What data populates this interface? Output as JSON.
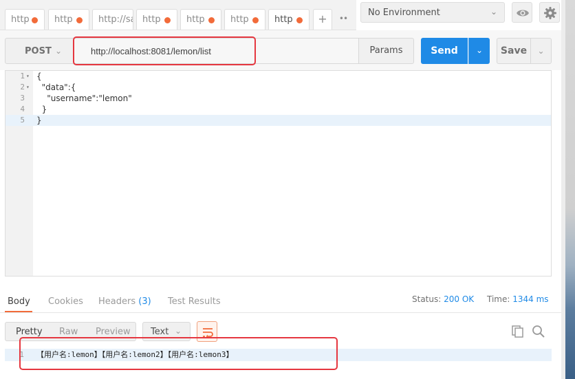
{
  "tabs": [
    {
      "label": "http",
      "active": false
    },
    {
      "label": "http",
      "active": false
    },
    {
      "label": "http://saa",
      "active": false
    },
    {
      "label": "http",
      "active": false
    },
    {
      "label": "http",
      "active": false
    },
    {
      "label": "http",
      "active": false
    },
    {
      "label": "http",
      "active": true
    }
  ],
  "tab_add": "+",
  "tab_more": "••",
  "environment": {
    "label": "No Environment"
  },
  "request": {
    "method": "POST",
    "url": "http://localhost:8081/lemon/list",
    "params_label": "Params",
    "send_label": "Send",
    "save_label": "Save"
  },
  "body_lines": [
    {
      "num": "1",
      "fold": "▾",
      "code": "{"
    },
    {
      "num": "2",
      "fold": "▾",
      "code": "  \"data\":{"
    },
    {
      "num": "3",
      "fold": "",
      "code": "    \"username\":\"lemon\""
    },
    {
      "num": "4",
      "fold": "",
      "code": "  }"
    },
    {
      "num": "5",
      "fold": "",
      "code": "}"
    }
  ],
  "response_tabs": {
    "body": "Body",
    "cookies": "Cookies",
    "headers": "Headers",
    "headers_count": "(3)",
    "test_results": "Test Results"
  },
  "status": {
    "status_label": "Status:",
    "status_value": "200 OK",
    "time_label": "Time:",
    "time_value": "1344 ms"
  },
  "response_view": {
    "pretty": "Pretty",
    "raw": "Raw",
    "preview": "Preview",
    "format": "Text"
  },
  "response_lines": [
    {
      "num": "1",
      "code": "【用户名:lemon】【用户名:lemon2】【用户名:lemon3】"
    }
  ],
  "colors": {
    "accent": "#f26b3a",
    "send": "#1f8ae6",
    "annotation": "#e5363f"
  }
}
